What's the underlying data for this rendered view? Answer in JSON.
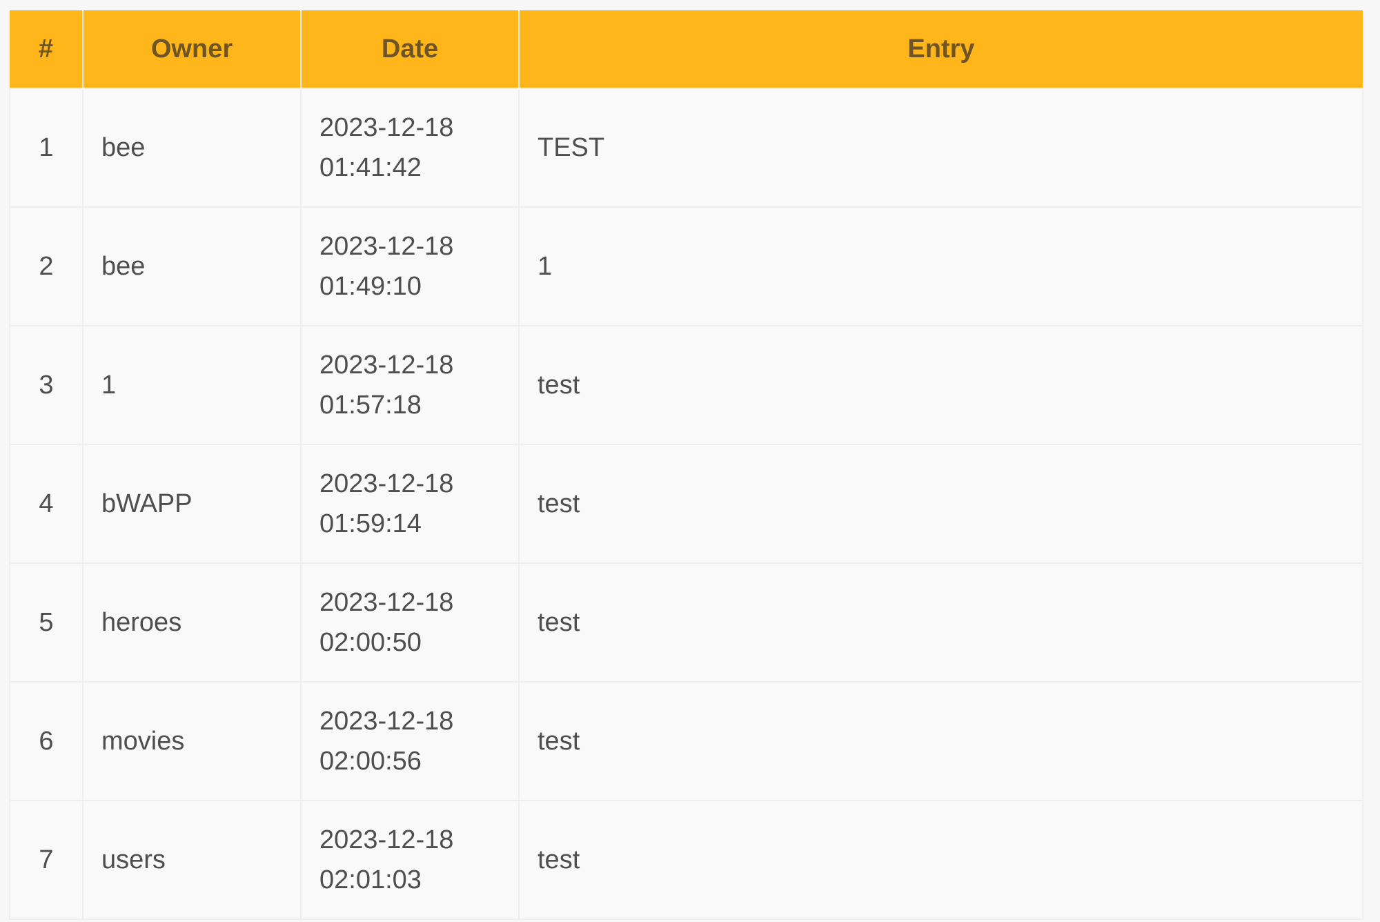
{
  "table": {
    "headers": [
      "#",
      "Owner",
      "Date",
      "Entry"
    ],
    "rows": [
      {
        "num": "1",
        "owner": "bee",
        "date": "2023-12-18",
        "time": "01:41:42",
        "entry": "TEST"
      },
      {
        "num": "2",
        "owner": "bee",
        "date": "2023-12-18",
        "time": "01:49:10",
        "entry": "1"
      },
      {
        "num": "3",
        "owner": "1",
        "date": "2023-12-18",
        "time": "01:57:18",
        "entry": "test"
      },
      {
        "num": "4",
        "owner": "bWAPP",
        "date": "2023-12-18",
        "time": "01:59:14",
        "entry": "test"
      },
      {
        "num": "5",
        "owner": "heroes",
        "date": "2023-12-18",
        "time": "02:00:50",
        "entry": "test"
      },
      {
        "num": "6",
        "owner": "movies",
        "date": "2023-12-18",
        "time": "02:00:56",
        "entry": "test"
      },
      {
        "num": "7",
        "owner": "users",
        "date": "2023-12-18",
        "time": "02:01:03",
        "entry": "test"
      }
    ]
  },
  "colors": {
    "header_bg": "#ffb61a",
    "header_text": "#6f5525",
    "row_bg": "#f9f9f9",
    "border": "#eeeeee",
    "text": "#4e4e4e"
  }
}
